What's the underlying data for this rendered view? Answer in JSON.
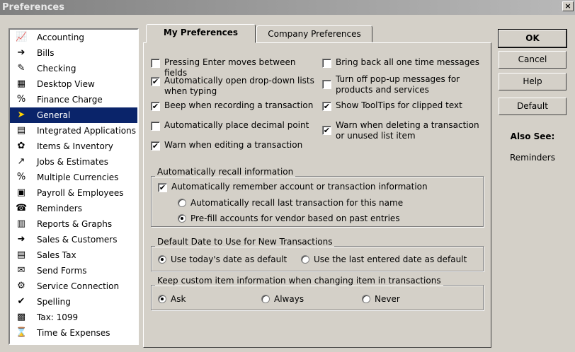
{
  "window": {
    "title": "Preferences",
    "close_glyph": "×"
  },
  "categories": [
    {
      "label": "Accounting",
      "icon": "accounting-icon",
      "glyph": "📈"
    },
    {
      "label": "Bills",
      "icon": "bills-icon",
      "glyph": "➔"
    },
    {
      "label": "Checking",
      "icon": "checking-icon",
      "glyph": "✎"
    },
    {
      "label": "Desktop View",
      "icon": "desktop-view-icon",
      "glyph": "▦"
    },
    {
      "label": "Finance Charge",
      "icon": "finance-charge-icon",
      "glyph": "%"
    },
    {
      "label": "General",
      "icon": "general-icon",
      "glyph": "➤"
    },
    {
      "label": "Integrated Applications",
      "icon": "integrated-applications-icon",
      "glyph": "▤"
    },
    {
      "label": "Items & Inventory",
      "icon": "items-inventory-icon",
      "glyph": "✿"
    },
    {
      "label": "Jobs & Estimates",
      "icon": "jobs-estimates-icon",
      "glyph": "↗"
    },
    {
      "label": "Multiple Currencies",
      "icon": "multiple-currencies-icon",
      "glyph": "%"
    },
    {
      "label": "Payroll & Employees",
      "icon": "payroll-employees-icon",
      "glyph": "▣"
    },
    {
      "label": "Reminders",
      "icon": "reminders-icon",
      "glyph": "☎"
    },
    {
      "label": "Reports & Graphs",
      "icon": "reports-graphs-icon",
      "glyph": "▥"
    },
    {
      "label": "Sales & Customers",
      "icon": "sales-customers-icon",
      "glyph": "➜"
    },
    {
      "label": "Sales Tax",
      "icon": "sales-tax-icon",
      "glyph": "▤"
    },
    {
      "label": "Send Forms",
      "icon": "send-forms-icon",
      "glyph": "✉"
    },
    {
      "label": "Service Connection",
      "icon": "service-connection-icon",
      "glyph": "⚙"
    },
    {
      "label": "Spelling",
      "icon": "spelling-icon",
      "glyph": "✔"
    },
    {
      "label": "Tax: 1099",
      "icon": "tax-1099-icon",
      "glyph": "▩"
    },
    {
      "label": "Time & Expenses",
      "icon": "time-expenses-icon",
      "glyph": "⌛"
    }
  ],
  "selected_category": "General",
  "tabs": {
    "my_preferences": "My Preferences",
    "company_preferences": "Company Preferences"
  },
  "options": {
    "pressing_enter": {
      "label": "Pressing Enter moves between fields",
      "checked": false
    },
    "auto_open_dropdown": {
      "label": "Automatically open drop-down lists when typing",
      "checked": true
    },
    "beep_recording": {
      "label": "Beep when recording a transaction",
      "checked": true
    },
    "auto_decimal": {
      "label": "Automatically place decimal point",
      "checked": false
    },
    "warn_editing": {
      "label": "Warn when editing a transaction",
      "checked": true
    },
    "bring_back_messages": {
      "label": "Bring back all one time messages",
      "checked": false
    },
    "turn_off_popups": {
      "label": "Turn off pop-up messages for products and services",
      "checked": false
    },
    "show_tooltips": {
      "label": "Show ToolTips for clipped text",
      "checked": true
    },
    "warn_deleting": {
      "label": "Warn when deleting a transaction or unused list item",
      "checked": true
    }
  },
  "recall": {
    "title": "Automatically recall information",
    "remember": {
      "label": "Automatically remember account or transaction information",
      "checked": true
    },
    "recall_last": {
      "label": "Automatically recall last transaction for this name",
      "selected": false
    },
    "prefill": {
      "label": "Pre-fill accounts for vendor based on past entries",
      "selected": true
    }
  },
  "default_date": {
    "title": "Default Date to Use for New Transactions",
    "today": {
      "label": "Use today's date as default",
      "selected": true
    },
    "last_entered": {
      "label": "Use the last entered date as default",
      "selected": false
    }
  },
  "custom_item": {
    "title": "Keep custom item information when changing item in transactions",
    "ask": {
      "label": "Ask",
      "selected": true
    },
    "always": {
      "label": "Always",
      "selected": false
    },
    "never": {
      "label": "Never",
      "selected": false
    }
  },
  "buttons": {
    "ok": "OK",
    "cancel": "Cancel",
    "help": "Help",
    "default": "Default"
  },
  "also_see": {
    "title": "Also See:",
    "link": "Reminders"
  }
}
